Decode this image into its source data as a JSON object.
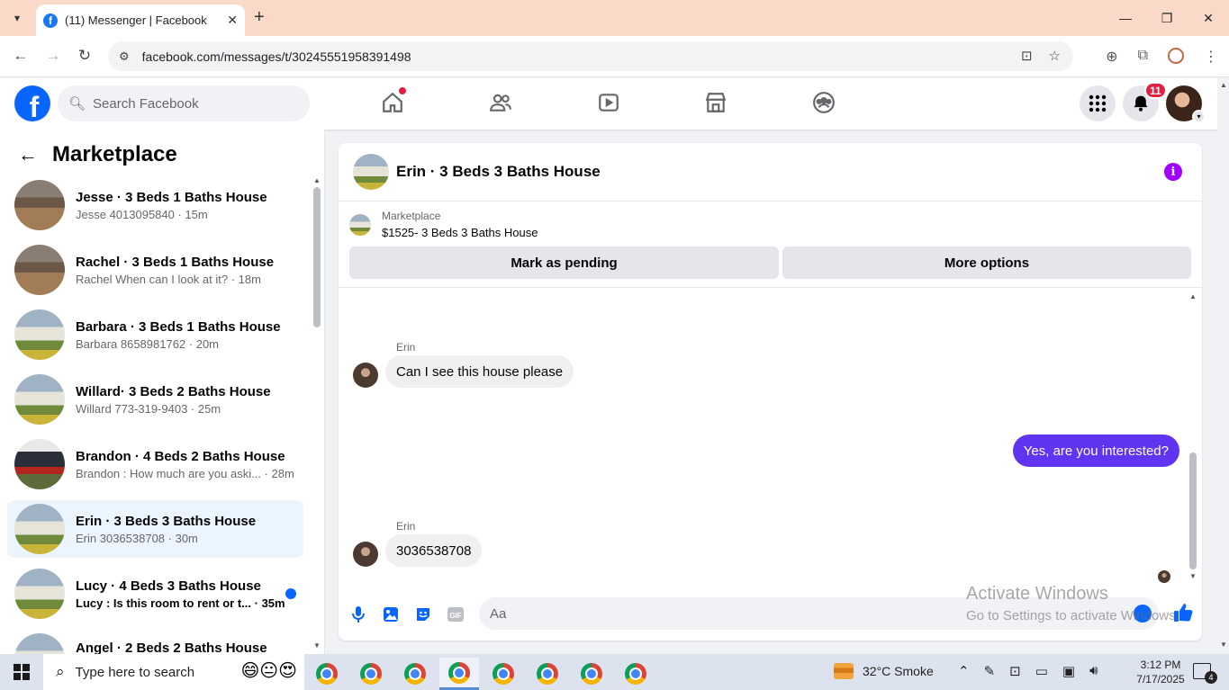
{
  "browser": {
    "tab_title": "(11) Messenger | Facebook",
    "url": "facebook.com/messages/t/30245551958391498"
  },
  "fb": {
    "search_placeholder": "Search Facebook",
    "notification_count": "11",
    "accent_color": "#0866ff"
  },
  "sidebar": {
    "title": "Marketplace",
    "conversations": [
      {
        "name": "Jesse · 3 Beds 1 Baths House",
        "preview": "Jesse 4013095840 · 15m",
        "thumb": "interior",
        "active": false,
        "unread": false
      },
      {
        "name": "Rachel · 3 Beds 1 Baths House",
        "preview": "Rachel When can I look at it? · 18m",
        "thumb": "interior",
        "active": false,
        "unread": false
      },
      {
        "name": "Barbara · 3 Beds 1 Baths House",
        "preview": "Barbara 8658981762 · 20m",
        "thumb": "house",
        "active": false,
        "unread": false
      },
      {
        "name": "Willard· 3 Beds 2 Baths House",
        "preview": "Willard 773-319-9403 · 25m",
        "thumb": "house",
        "active": false,
        "unread": false
      },
      {
        "name": "Brandon · 4 Beds 2 Baths House",
        "preview": "Brandon : How much are you aski... · 28m",
        "thumb": "house2",
        "active": false,
        "unread": false
      },
      {
        "name": "Erin · 3 Beds 3 Baths House",
        "preview": "Erin 3036538708 · 30m",
        "thumb": "house",
        "active": true,
        "unread": false
      },
      {
        "name": "Lucy · 4 Beds 3 Baths House",
        "preview": "Lucy : Is this room to rent or t... · 35m",
        "thumb": "house",
        "active": false,
        "unread": true
      },
      {
        "name": "Angel · 2 Beds 2 Baths House",
        "preview": "",
        "thumb": "house",
        "active": false,
        "unread": false
      }
    ]
  },
  "chat": {
    "title": "Erin · 3 Beds 3 Baths House",
    "marketplace_label": "Marketplace",
    "listing": "$1525- 3 Beds 3 Baths House",
    "mark_pending": "Mark as pending",
    "more_options": "More options",
    "messages": [
      {
        "sender": "Erin",
        "text": "Can I see this house please",
        "direction": "in"
      },
      {
        "sender": "",
        "text": "Yes, are you interested?",
        "direction": "out"
      },
      {
        "sender": "Erin",
        "text": "3036538708",
        "direction": "in"
      }
    ],
    "composer_placeholder": "Aa",
    "outgoing_color": "#6034f0"
  },
  "watermark": {
    "line1": "Activate Windows",
    "line2": "Go to Settings to activate Windows."
  },
  "taskbar": {
    "search_placeholder": "Type here to search",
    "weather": "32°C  Smoke",
    "time": "3:12 PM",
    "date": "7/17/2025",
    "notification_count": "4"
  }
}
